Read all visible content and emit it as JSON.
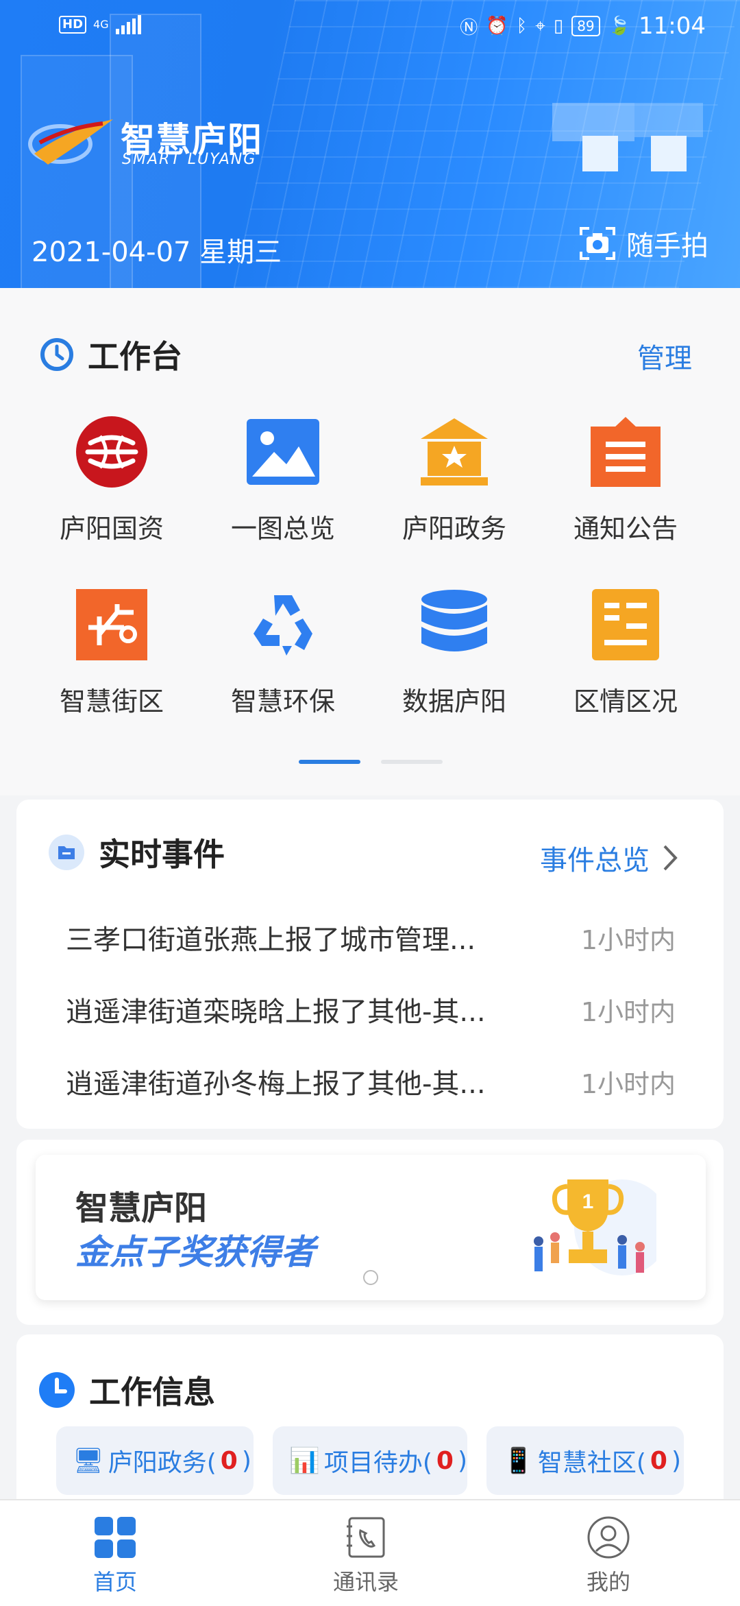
{
  "status_bar": {
    "hd": "HD",
    "network": "4G",
    "battery": "89",
    "time": "11:04"
  },
  "header": {
    "logo_cn": "智慧庐阳",
    "logo_en": "SMART LUYANG",
    "date": "2021-04-07 星期三",
    "snap_label": "随手拍"
  },
  "workbench": {
    "title": "工作台",
    "manage_label": "管理",
    "apps": [
      {
        "label": "庐阳国资",
        "icon": "guozi-icon",
        "color": "#c8161d"
      },
      {
        "label": "一图总览",
        "icon": "image-icon",
        "color": "#2f7ff0"
      },
      {
        "label": "庐阳政务",
        "icon": "government-icon",
        "color": "#f5a623"
      },
      {
        "label": "通知公告",
        "icon": "notice-icon",
        "color": "#f2662a"
      },
      {
        "label": "智慧街区",
        "icon": "street-icon",
        "color": "#f2662a"
      },
      {
        "label": "智慧环保",
        "icon": "recycle-icon",
        "color": "#2f7ff0"
      },
      {
        "label": "数据庐阳",
        "icon": "database-icon",
        "color": "#2f7ff0"
      },
      {
        "label": "区情区况",
        "icon": "district-icon",
        "color": "#f5a623"
      }
    ],
    "page": 1,
    "page_count": 2
  },
  "events": {
    "title": "实时事件",
    "more_label": "事件总览",
    "items": [
      {
        "text": "三孝口街道张燕上报了城市管理...",
        "time": "1小时内"
      },
      {
        "text": "逍遥津街道栾晓晗上报了其他-其...",
        "time": "1小时内"
      },
      {
        "text": "逍遥津街道孙冬梅上报了其他-其...",
        "time": "1小时内"
      }
    ]
  },
  "banner": {
    "line1": "智慧庐阳",
    "line2": "金点子奖获得者"
  },
  "work_info": {
    "title": "工作信息",
    "chips": [
      {
        "label": "庐阳政务(",
        "count": "0",
        "close": ")"
      },
      {
        "label": "项目待办(",
        "count": "0",
        "close": ")"
      },
      {
        "label": "智慧社区(",
        "count": "0",
        "close": ")"
      }
    ]
  },
  "tabbar": {
    "items": [
      {
        "label": "首页",
        "icon": "home-grid-icon",
        "active": true
      },
      {
        "label": "通讯录",
        "icon": "contacts-icon",
        "active": false
      },
      {
        "label": "我的",
        "icon": "profile-icon",
        "active": false
      }
    ]
  },
  "colors": {
    "brand_blue": "#1f7df6",
    "link_blue": "#2a7de1",
    "count_red": "#e02020"
  }
}
